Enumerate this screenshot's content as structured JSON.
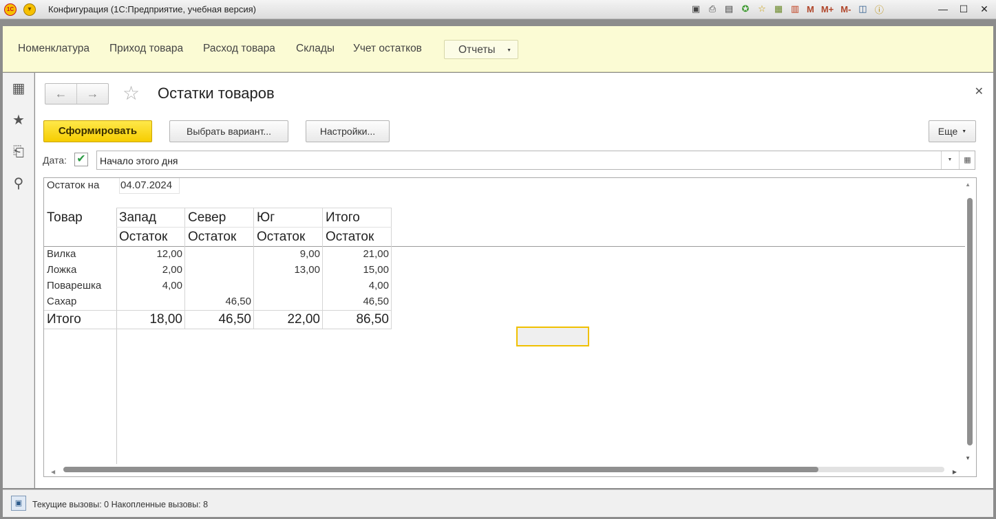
{
  "window": {
    "title": "Конфигурация  (1С:Предприятие, учебная версия)",
    "logo_text": "1C"
  },
  "toolbar_icons": [
    "save-icon",
    "print-icon",
    "preview-icon",
    "add-favorite-icon",
    "favorites-icon",
    "calculator-icon",
    "calendar-icon"
  ],
  "memory_buttons": [
    "M",
    "M+",
    "M-"
  ],
  "sections": [
    "Номенклатура",
    "Приход товара",
    "Расход товара",
    "Склады",
    "Учет остатков"
  ],
  "reports_menu": {
    "label": "Отчеты"
  },
  "left_nav_icons": [
    "apps-grid-icon",
    "favorites-star-icon",
    "history-icon",
    "search-icon"
  ],
  "form": {
    "title": "Остатки товаров",
    "buttons": {
      "generate": "Сформировать",
      "choose_variant": "Выбрать вариант...",
      "settings": "Настройки...",
      "more": "Еще"
    },
    "date_label": "Дата:",
    "date_checked": true,
    "date_value": "Начало этого дня"
  },
  "report": {
    "balance_label": "Остаток на",
    "balance_date": "04.07.2024",
    "row_header": "Товар",
    "columns": [
      "Запад",
      "Север",
      "Юг",
      "Итого"
    ],
    "subheader": "Остаток",
    "rows": [
      {
        "name": "Вилка",
        "values": [
          "12,00",
          "",
          "9,00",
          "21,00"
        ]
      },
      {
        "name": "Ложка",
        "values": [
          "2,00",
          "",
          "13,00",
          "15,00"
        ]
      },
      {
        "name": "Поварешка",
        "values": [
          "4,00",
          "",
          "",
          "4,00"
        ]
      },
      {
        "name": "Сахар",
        "values": [
          "",
          "46,50",
          "",
          "46,50"
        ]
      }
    ],
    "total": {
      "name": "Итого",
      "values": [
        "18,00",
        "46,50",
        "22,00",
        "86,50"
      ]
    }
  },
  "status": {
    "text": "Текущие вызовы: 0   Накопленные вызовы: 8"
  }
}
